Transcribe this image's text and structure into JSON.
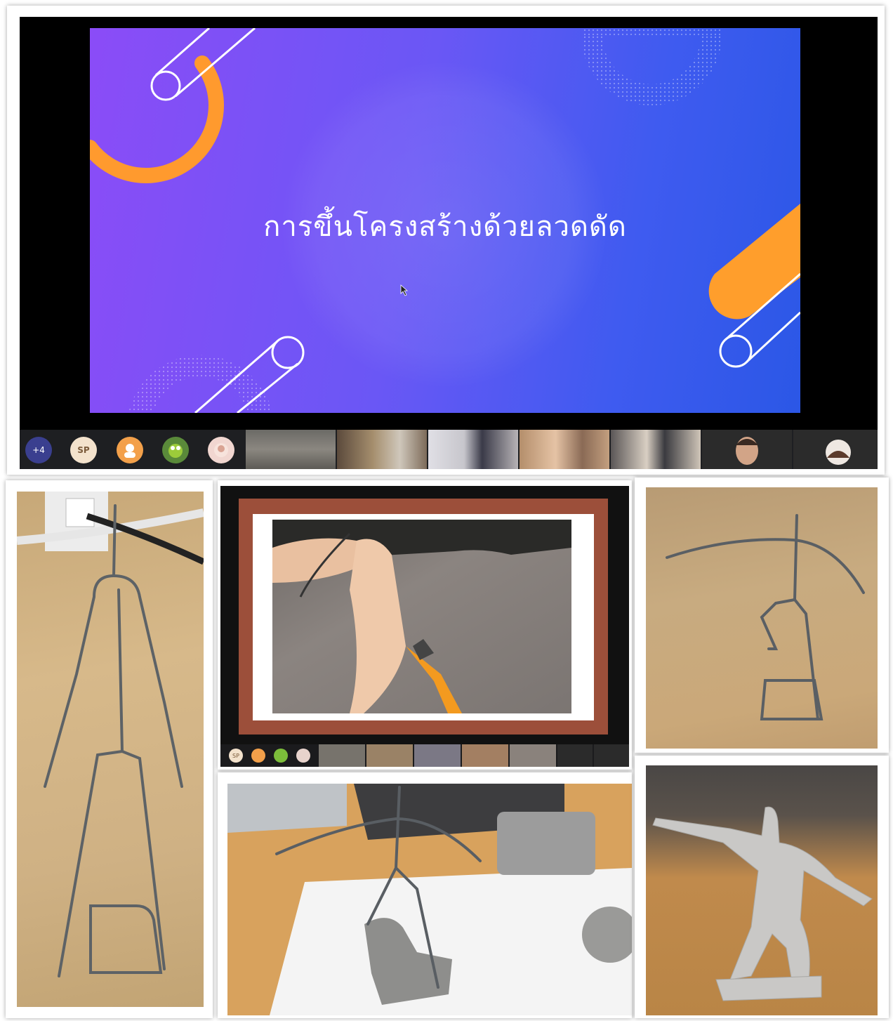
{
  "slide": {
    "title": "การขึ้นโครงสร้างด้วยลวดดัด"
  },
  "participants": {
    "more_count": "+4",
    "initials": "SP",
    "initials_small": "SP"
  },
  "colors": {
    "slide_left": "#8b4cf7",
    "slide_right": "#2b57e6",
    "accent_orange": "#ff9a2e",
    "frame_brown": "#9c4f3a"
  },
  "icons": [
    "participant-avatar",
    "cursor-pointer"
  ]
}
